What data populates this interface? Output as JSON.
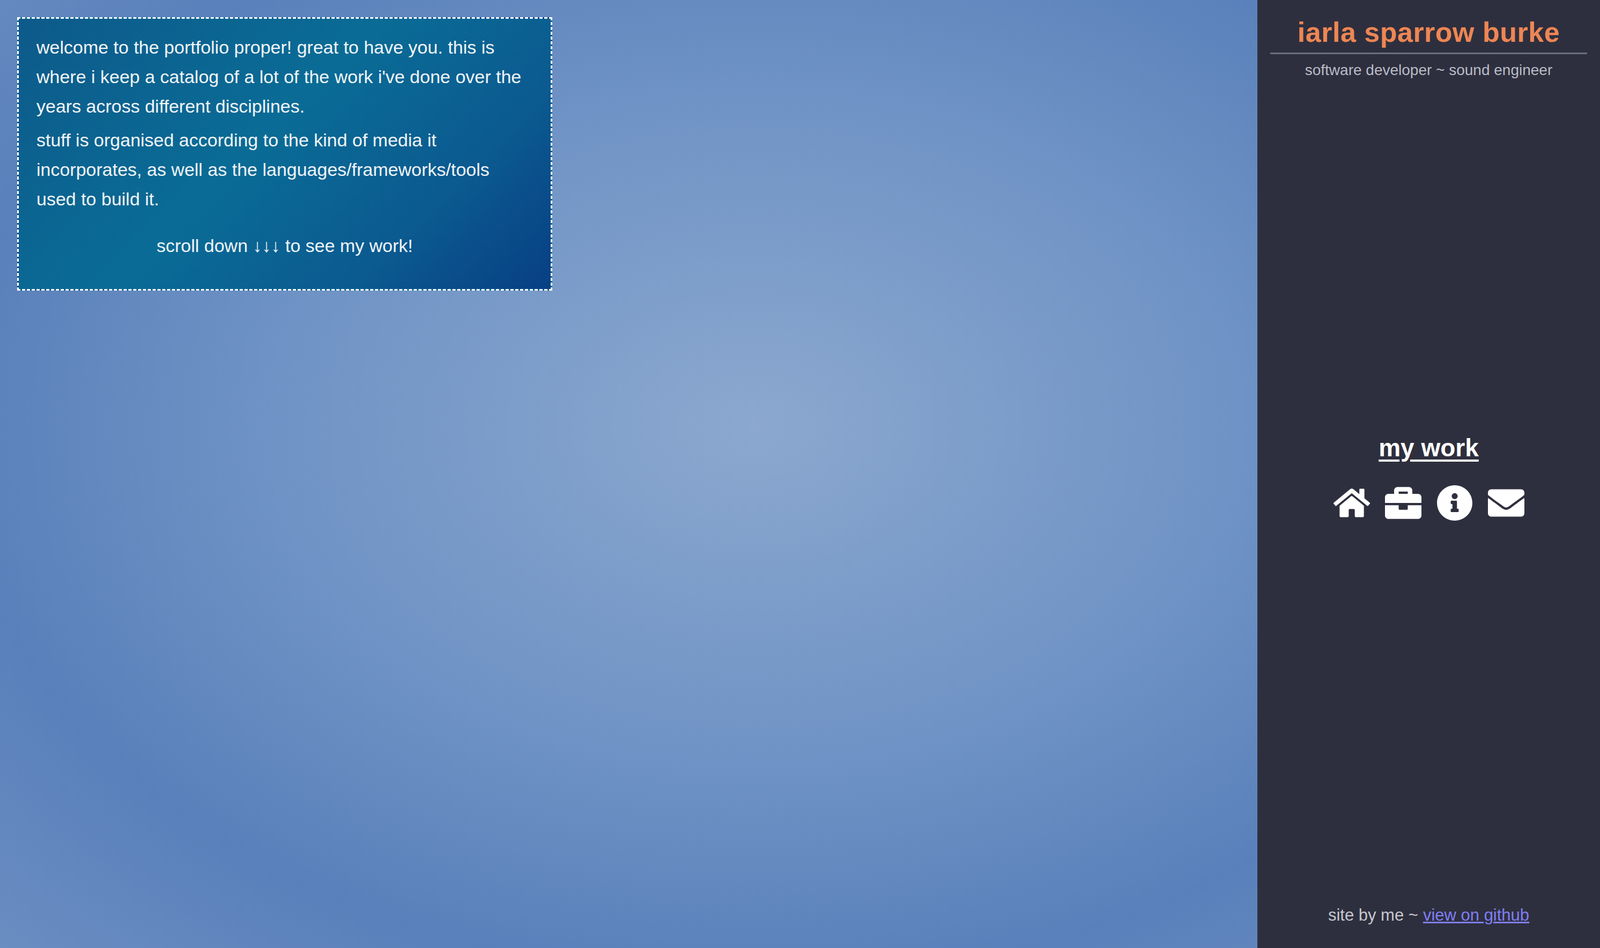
{
  "intro": {
    "paragraphs": [
      "welcome to the portfolio proper! great to have you. this is where i keep a catalog of a lot of the work i've done over the years across different disciplines.",
      "stuff is organised according to the kind of media it incorporates, as well as the languages/frameworks/tools used to build it."
    ],
    "scroll_hint": "scroll down ↓↓↓ to see my work!"
  },
  "sidebar": {
    "name": "iarla sparrow burke",
    "tagline": "software developer ~ sound engineer",
    "page_title": "my work",
    "footer": {
      "credit": "site by me ~",
      "link": "view on github"
    }
  }
}
